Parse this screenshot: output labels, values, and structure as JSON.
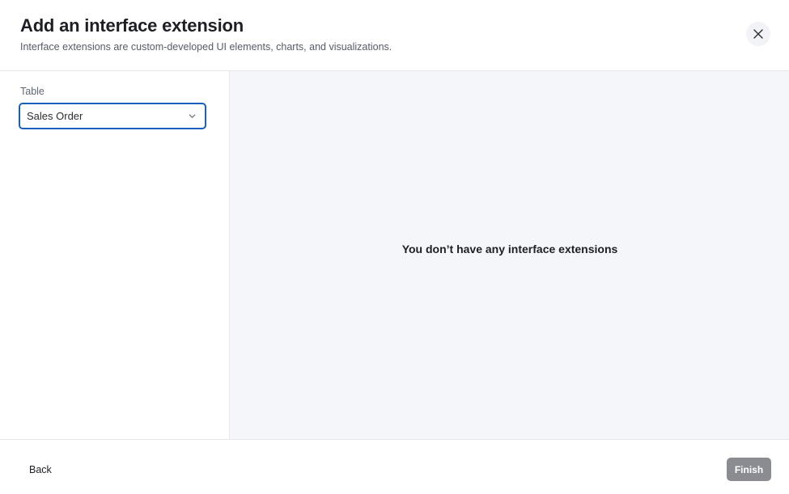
{
  "header": {
    "title": "Add an interface extension",
    "subtitle": "Interface extensions are custom-developed UI elements, charts, and visualizations.",
    "close_icon": "close-icon"
  },
  "table_field": {
    "label": "Table",
    "selected_value": "Sales Order",
    "chevron_icon": "chevron-down-icon"
  },
  "main": {
    "empty_message": "You don’t have any interface extensions"
  },
  "footer": {
    "back_label": "Back",
    "finish_label": "Finish"
  },
  "colors": {
    "accent": "#1b5fbe",
    "panel_bg": "#f5f6f9",
    "finish_disabled": "#8a8c91"
  }
}
